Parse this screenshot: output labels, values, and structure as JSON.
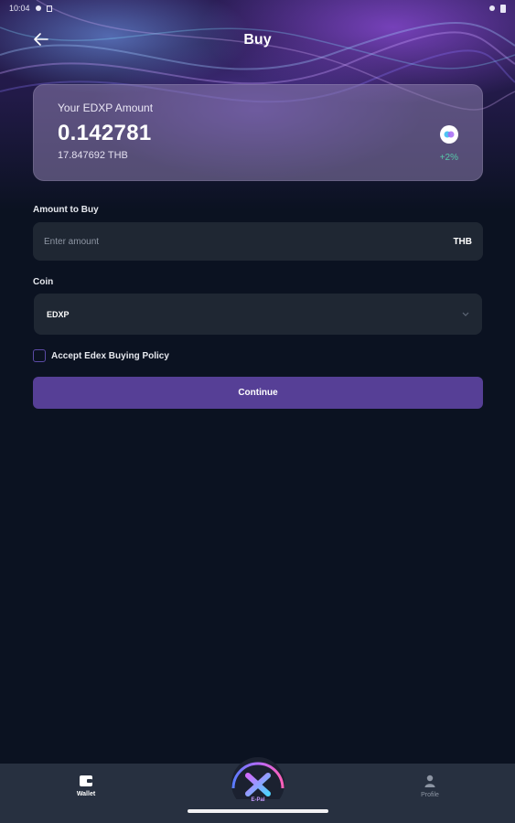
{
  "status_bar": {
    "time": "10:04"
  },
  "header": {
    "title": "Buy",
    "back_icon": "arrow-left-icon"
  },
  "balance_card": {
    "label": "Your EDXP Amount",
    "amount": "0.142781",
    "fiat_value": "17.847692 THB",
    "change": "+2%",
    "coin_icon": "edxp-coin-icon"
  },
  "amount_field": {
    "label": "Amount to Buy",
    "placeholder": "Enter amount",
    "value": "",
    "currency": "THB"
  },
  "coin_field": {
    "label": "Coin",
    "selected": "EDXP",
    "icon": "chevron-down-icon"
  },
  "policy": {
    "label": "Accept Edex Buying Policy",
    "checked": false
  },
  "continue_button": {
    "label": "Continue"
  },
  "bottom_nav": {
    "items": [
      {
        "label": "Wallet",
        "icon": "wallet-icon",
        "active": true
      },
      {
        "label": "E-Pal",
        "icon": "x-logo-icon",
        "active": false
      },
      {
        "label": "Profile",
        "icon": "person-icon",
        "active": false
      }
    ]
  },
  "colors": {
    "background": "#0b1221",
    "card": "#1f2733",
    "accent": "#563f96",
    "positive": "#56c7a8",
    "nav_bg": "#273040"
  }
}
